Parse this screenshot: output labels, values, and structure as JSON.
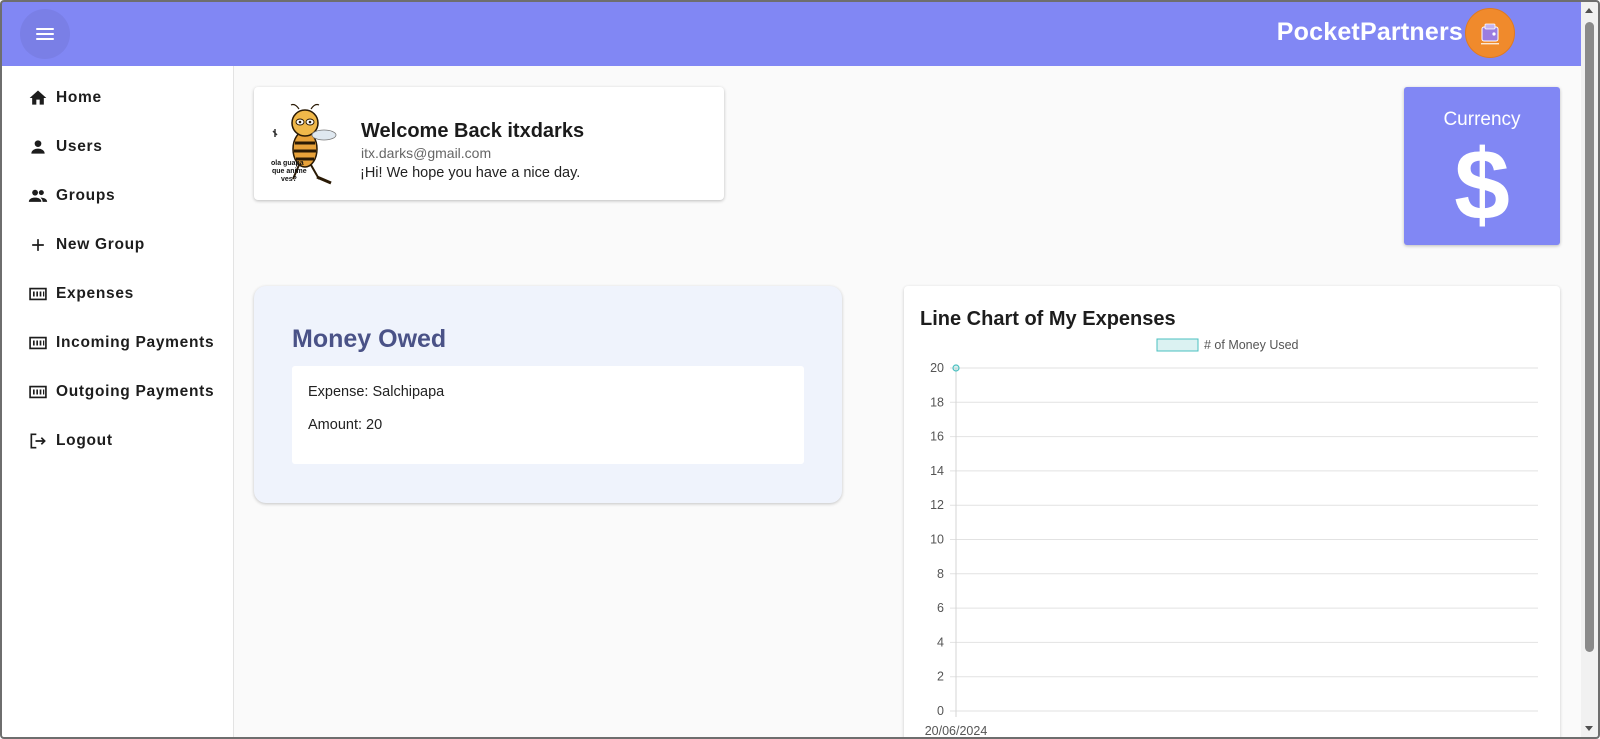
{
  "header": {
    "app_title": "PocketPartners",
    "menu_icon": "hamburger-menu-icon",
    "logo_icon": "pocket-partners-logo",
    "brand_color": "#8187f4",
    "logo_color": "#f08a2c"
  },
  "sidebar": {
    "items": [
      {
        "label": "Home",
        "icon": "home-icon"
      },
      {
        "label": "Users",
        "icon": "person-icon"
      },
      {
        "label": "Groups",
        "icon": "people-icon"
      },
      {
        "label": "New Group",
        "icon": "plus-icon"
      },
      {
        "label": "Expenses",
        "icon": "receipt-icon"
      },
      {
        "label": "Incoming Payments",
        "icon": "receipt-icon"
      },
      {
        "label": "Outgoing Payments",
        "icon": "receipt-icon"
      },
      {
        "label": "Logout",
        "icon": "logout-icon"
      }
    ]
  },
  "welcome": {
    "title": "Welcome Back itxdarks",
    "email": "itx.darks@gmail.com",
    "message": "¡Hi! We hope you have a nice day."
  },
  "currency": {
    "title": "Currency",
    "symbol": "$"
  },
  "money_owed": {
    "title": "Money Owed",
    "expense_line": "Expense: Salchipapa",
    "amount_line": "Amount: 20",
    "card_bg": "#eff3fc",
    "title_color": "#4a5287"
  },
  "chart_data": {
    "type": "line",
    "title": "Line Chart of My Expenses",
    "x": [
      "20/06/2024"
    ],
    "series": [
      {
        "name": "# of Money Used",
        "values": [
          20
        ],
        "color": "#4bc0c0"
      }
    ],
    "ylim": [
      0,
      20
    ],
    "yticks": [
      0,
      2,
      4,
      6,
      8,
      10,
      12,
      14,
      16,
      18,
      20
    ],
    "legend": "top-center",
    "grid": true
  }
}
